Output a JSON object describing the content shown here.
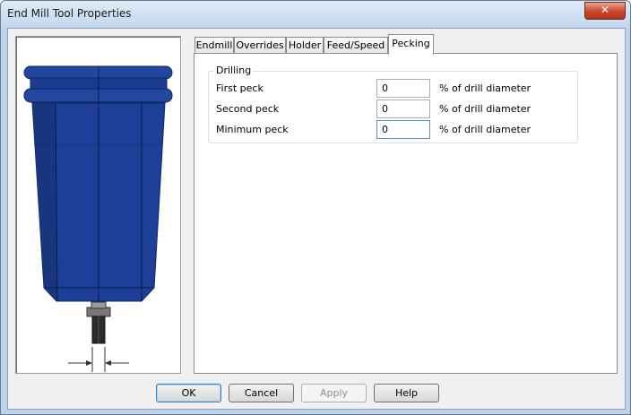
{
  "window": {
    "title": "End Mill Tool Properties",
    "close_glyph": "✕"
  },
  "tabs": [
    {
      "label": "Endmill",
      "active": false
    },
    {
      "label": "Overrides",
      "active": false
    },
    {
      "label": "Holder",
      "active": false
    },
    {
      "label": "Feed/Speed",
      "active": false
    },
    {
      "label": "Pecking",
      "active": true
    }
  ],
  "drilling": {
    "group_title": "Drilling",
    "rows": [
      {
        "label": "First peck",
        "value": "0",
        "unit": "% of drill diameter"
      },
      {
        "label": "Second peck",
        "value": "0",
        "unit": "% of drill diameter"
      },
      {
        "label": "Minimum peck",
        "value": "0",
        "unit": "% of drill diameter"
      }
    ]
  },
  "buttons": {
    "ok": "OK",
    "cancel": "Cancel",
    "apply": "Apply",
    "help": "Help"
  },
  "colors": {
    "holder_blue": "#1e3f98",
    "holder_dark": "#0f2466",
    "titlebar": "#c9dbef",
    "close_red": "#c9462c"
  },
  "icons": {
    "preview": "tool-holder-preview",
    "close": "close-icon"
  }
}
